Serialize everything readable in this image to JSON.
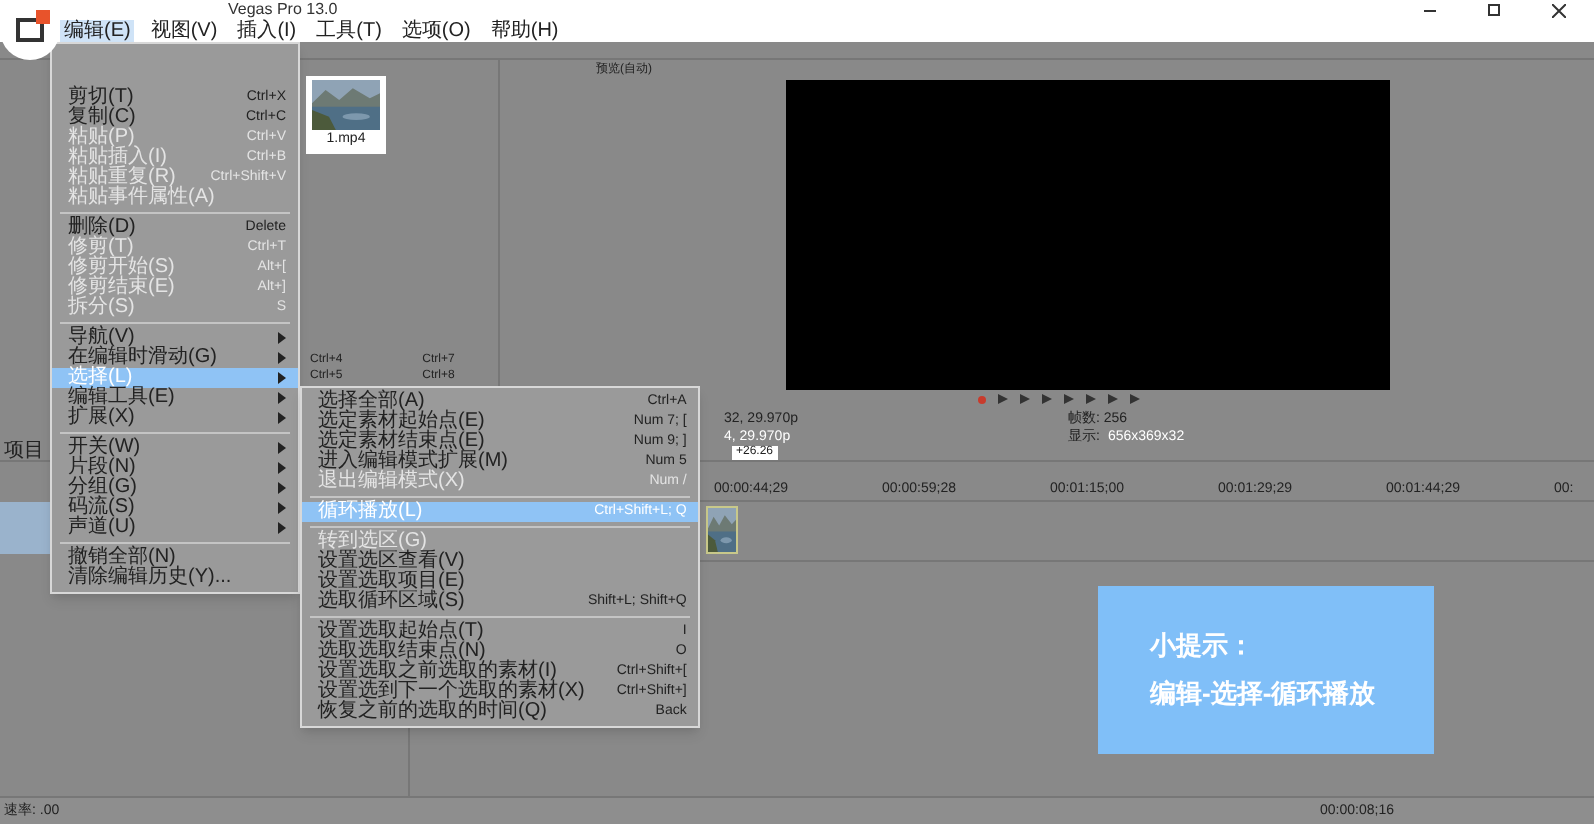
{
  "window": {
    "title": "Vegas Pro 13.0"
  },
  "menubar": [
    {
      "label": "编辑(E)",
      "selected": true
    },
    {
      "label": "视图(V)",
      "selected": false
    },
    {
      "label": "插入(I)",
      "selected": false
    },
    {
      "label": "工具(T)",
      "selected": false
    },
    {
      "label": "选项(O)",
      "selected": false
    },
    {
      "label": "帮助(H)",
      "selected": false
    }
  ],
  "edit_menu": [
    {
      "kind": "item",
      "label": "剪切(T)",
      "shortcut": "Ctrl+X",
      "disabled": false,
      "selected": false,
      "submenu": false
    },
    {
      "kind": "item",
      "label": "复制(C)",
      "shortcut": "Ctrl+C",
      "disabled": false,
      "selected": false,
      "submenu": false
    },
    {
      "kind": "item",
      "label": "粘贴(P)",
      "shortcut": "Ctrl+V",
      "disabled": true,
      "selected": false,
      "submenu": false
    },
    {
      "kind": "item",
      "label": "粘贴插入(I)",
      "shortcut": "Ctrl+B",
      "disabled": true,
      "selected": false,
      "submenu": false
    },
    {
      "kind": "item",
      "label": "粘贴重复(R)",
      "shortcut": "Ctrl+Shift+V",
      "disabled": true,
      "selected": false,
      "submenu": false
    },
    {
      "kind": "item",
      "label": "粘贴事件属性(A)",
      "disabled": true,
      "selected": false,
      "submenu": false
    },
    {
      "kind": "separator"
    },
    {
      "kind": "item",
      "label": "删除(D)",
      "shortcut": "Delete",
      "disabled": false,
      "selected": false,
      "submenu": false
    },
    {
      "kind": "item",
      "label": "修剪(T)",
      "shortcut": "Ctrl+T",
      "disabled": true,
      "selected": false,
      "submenu": false
    },
    {
      "kind": "item",
      "label": "修剪开始(S)",
      "shortcut": "Alt+[",
      "disabled": true,
      "selected": false,
      "submenu": false
    },
    {
      "kind": "item",
      "label": "修剪结束(E)",
      "shortcut": "Alt+]",
      "disabled": true,
      "selected": false,
      "submenu": false
    },
    {
      "kind": "item",
      "label": "拆分(S)",
      "shortcut": "S",
      "disabled": true,
      "selected": false,
      "submenu": false
    },
    {
      "kind": "separator"
    },
    {
      "kind": "item",
      "label": "导航(V)",
      "disabled": false,
      "selected": false,
      "submenu": true
    },
    {
      "kind": "item",
      "label": "在编辑时滑动(G)",
      "disabled": false,
      "selected": false,
      "submenu": true
    },
    {
      "kind": "item",
      "label": "选择(L)",
      "disabled": false,
      "selected": true,
      "submenu": true
    },
    {
      "kind": "item",
      "label": "编辑工具(E)",
      "disabled": false,
      "selected": false,
      "submenu": true
    },
    {
      "kind": "item",
      "label": "扩展(X)",
      "disabled": false,
      "selected": false,
      "submenu": true
    },
    {
      "kind": "separator"
    },
    {
      "kind": "item",
      "label": "开关(W)",
      "disabled": false,
      "selected": false,
      "submenu": true
    },
    {
      "kind": "item",
      "label": "片段(N)",
      "disabled": false,
      "selected": false,
      "submenu": true
    },
    {
      "kind": "item",
      "label": "分组(G)",
      "disabled": false,
      "selected": false,
      "submenu": true
    },
    {
      "kind": "item",
      "label": "码流(S)",
      "disabled": false,
      "selected": false,
      "submenu": true
    },
    {
      "kind": "item",
      "label": "声道(U)",
      "disabled": false,
      "selected": false,
      "submenu": true
    },
    {
      "kind": "separator"
    },
    {
      "kind": "item",
      "label": "撤销全部(N)",
      "disabled": false,
      "selected": false,
      "submenu": false
    },
    {
      "kind": "item",
      "label": "清除编辑历史(Y)...",
      "disabled": false,
      "selected": false,
      "submenu": false
    }
  ],
  "select_submenu": [
    {
      "kind": "item",
      "label": "选择全部(A)",
      "shortcut": "Ctrl+A",
      "disabled": false,
      "selected": false
    },
    {
      "kind": "item",
      "label": "选定素材起始点(E)",
      "shortcut": "Num 7; [",
      "disabled": false,
      "selected": false
    },
    {
      "kind": "item",
      "label": "选定素材结束点(E)",
      "shortcut": "Num 9; ]",
      "disabled": false,
      "selected": false
    },
    {
      "kind": "item",
      "label": "进入编辑模式扩展(M)",
      "shortcut": "Num 5",
      "disabled": false,
      "selected": false
    },
    {
      "kind": "item",
      "label": "退出编辑模式(X)",
      "shortcut": "Num /",
      "disabled": true,
      "selected": false
    },
    {
      "kind": "separator"
    },
    {
      "kind": "item",
      "label": "循环播放(L)",
      "shortcut": "Ctrl+Shift+L; Q",
      "disabled": false,
      "selected": true
    },
    {
      "kind": "separator"
    },
    {
      "kind": "item",
      "label": "转到选区(G)",
      "disabled": true,
      "selected": false
    },
    {
      "kind": "item",
      "label": "设置选区查看(V)",
      "disabled": false,
      "selected": false
    },
    {
      "kind": "item",
      "label": "设置选取项目(E)",
      "disabled": false,
      "selected": false
    },
    {
      "kind": "item",
      "label": "选取循环区域(S)",
      "shortcut": "Shift+L; Shift+Q",
      "disabled": false,
      "selected": false
    },
    {
      "kind": "separator"
    },
    {
      "kind": "item",
      "label": "设置选取起始点(T)",
      "shortcut": "I",
      "disabled": false,
      "selected": false
    },
    {
      "kind": "item",
      "label": "选取选取结束点(N)",
      "shortcut": "O",
      "disabled": false,
      "selected": false
    },
    {
      "kind": "item",
      "label": "设置选取之前选取的素材(I)",
      "shortcut": "Ctrl+Shift+[",
      "disabled": false,
      "selected": false
    },
    {
      "kind": "item",
      "label": "设置选到下一个选取的素材(X)",
      "shortcut": "Ctrl+Shift+]",
      "disabled": false,
      "selected": false
    },
    {
      "kind": "item",
      "label": "恢复之前的选取的时间(Q)",
      "shortcut": "Back",
      "disabled": false,
      "selected": false
    }
  ],
  "media": {
    "filename": "1.mp4",
    "shortcuts": [
      "Ctrl+4",
      "Ctrl+7",
      "Ctrl+5",
      "Ctrl+8"
    ]
  },
  "left_tab": "项目",
  "preview": {
    "quality": "预览(自动)",
    "project_info": [
      "32, 29.970p",
      "4, 29.970p"
    ],
    "frame": "帧数: 256",
    "display_label": "显示:",
    "display_value": "656x369x32"
  },
  "timeline": {
    "marker": "+26.26",
    "ticks": [
      "00:00:44;29",
      "00:00:59;28",
      "00:01:15;00",
      "00:01:29;29",
      "00:01:44;29",
      "00:"
    ]
  },
  "tip": {
    "title": "小提示：",
    "text": "编辑-选择-循环播放"
  },
  "status": {
    "rate": "速率: .00",
    "time": "00:00:08;16"
  }
}
